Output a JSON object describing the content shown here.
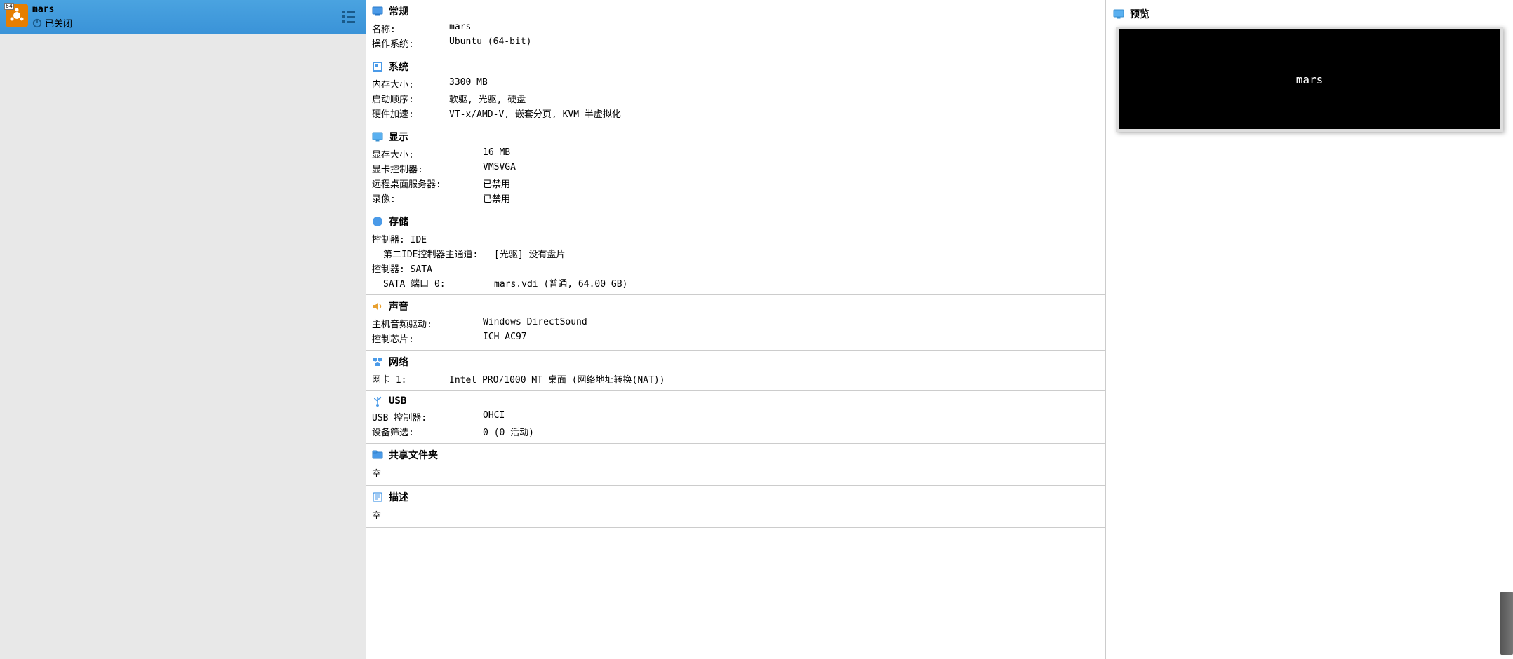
{
  "sidebar": {
    "vm": {
      "badge": "64",
      "name": "mars",
      "status": "已关闭"
    }
  },
  "details": {
    "general": {
      "title": "常规",
      "name_label": "名称:",
      "name_value": "mars",
      "os_label": "操作系统:",
      "os_value": "Ubuntu (64-bit)"
    },
    "system": {
      "title": "系统",
      "mem_label": "内存大小:",
      "mem_value": "3300 MB",
      "boot_label": "启动顺序:",
      "boot_value": "软驱, 光驱, 硬盘",
      "accel_label": "硬件加速:",
      "accel_value": "VT-x/AMD-V, 嵌套分页, KVM 半虚拟化"
    },
    "display": {
      "title": "显示",
      "vram_label": "显存大小:",
      "vram_value": "16 MB",
      "ctrl_label": "显卡控制器:",
      "ctrl_value": "VMSVGA",
      "rdp_label": "远程桌面服务器:",
      "rdp_value": "已禁用",
      "rec_label": "录像:",
      "rec_value": "已禁用"
    },
    "storage": {
      "title": "存储",
      "ctrl_ide": "控制器: IDE",
      "ide_ch_label": "第二IDE控制器主通道:",
      "ide_ch_value": "[光驱] 没有盘片",
      "ctrl_sata": "控制器: SATA",
      "sata_port_label": "SATA 端口 0:",
      "sata_port_value": "mars.vdi (普通, 64.00 GB)"
    },
    "audio": {
      "title": "声音",
      "drv_label": "主机音频驱动:",
      "drv_value": "Windows DirectSound",
      "chip_label": "控制芯片:",
      "chip_value": "ICH AC97"
    },
    "network": {
      "title": "网络",
      "nic_label": "网卡 1:",
      "nic_value": "Intel PRO/1000 MT 桌面 (网络地址转换(NAT))"
    },
    "usb": {
      "title": "USB",
      "ctrl_label": "USB 控制器:",
      "ctrl_value": "OHCI",
      "filter_label": "设备筛选:",
      "filter_value": "0 (0 活动)"
    },
    "shared": {
      "title": "共享文件夹",
      "value": "空"
    },
    "desc": {
      "title": "描述",
      "value": "空"
    }
  },
  "preview": {
    "title": "预览",
    "text": "mars"
  }
}
